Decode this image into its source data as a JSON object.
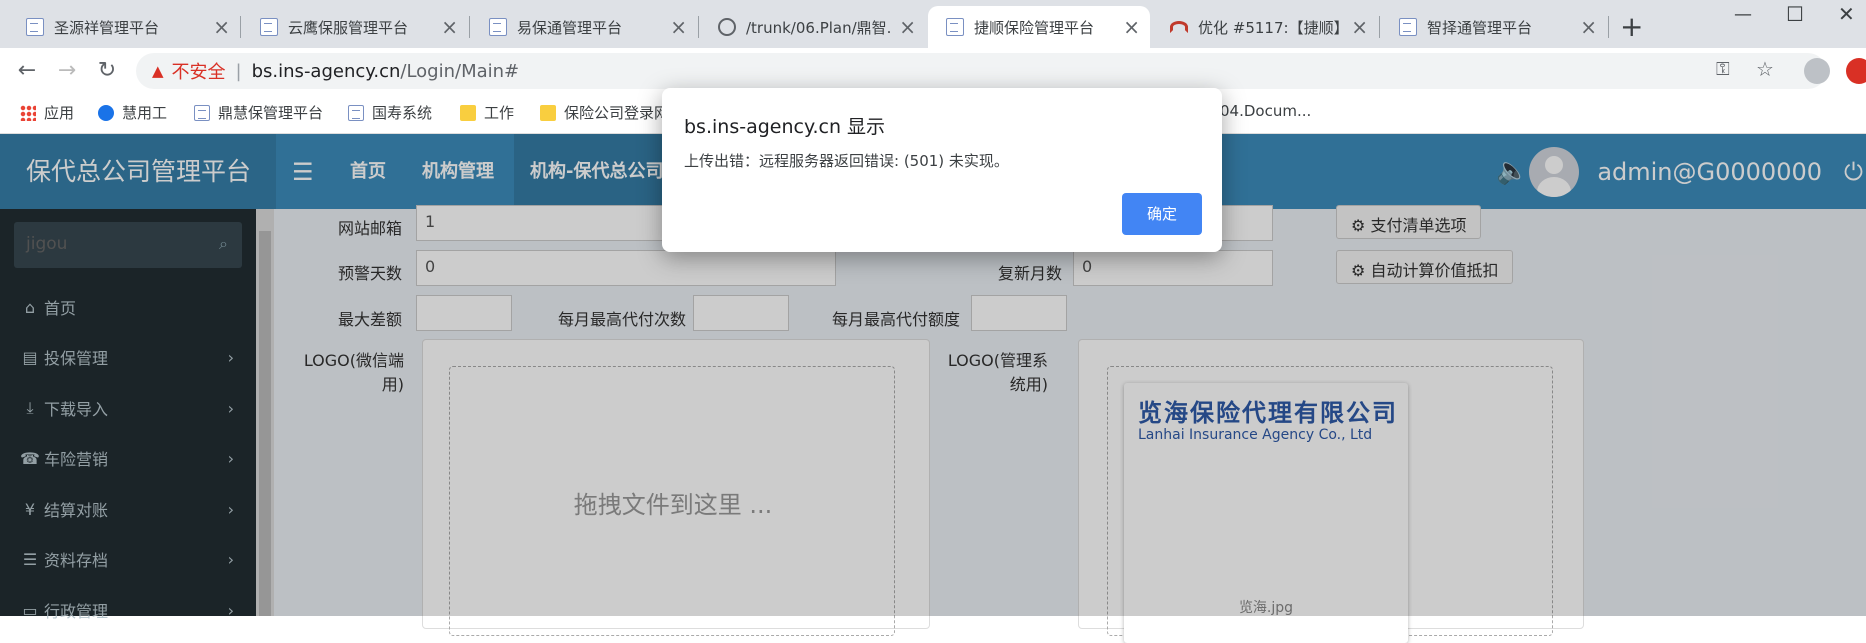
{
  "tabs": [
    {
      "label": "圣源祥管理平台"
    },
    {
      "label": "云鹰保服管理平台"
    },
    {
      "label": "易保通管理平台"
    },
    {
      "label": "/trunk/06.Plan/鼎智..."
    },
    {
      "label": "捷顺保险管理平台"
    },
    {
      "label": "优化 #5117:【捷顺】..."
    },
    {
      "label": "智择通管理平台"
    }
  ],
  "window_controls": {
    "minimize": "—",
    "maximize": "☐",
    "close": "✕",
    "new_tab": "+"
  },
  "address": {
    "not_secure": "不安全",
    "host": "bs.ins-agency.cn",
    "path": "/Login/Main#"
  },
  "bookmarks": [
    {
      "label": "应用"
    },
    {
      "label": "慧用工"
    },
    {
      "label": "鼎慧保管理平台"
    },
    {
      "label": "国寿系统"
    },
    {
      "label": "工作"
    },
    {
      "label": "保险公司登录网..."
    },
    {
      "label": "04.Docum..."
    }
  ],
  "app": {
    "brand": "保代总公司管理平台",
    "nav": [
      "首页",
      "机构管理",
      "机构-保代总公司"
    ],
    "user": "admin@G0000000"
  },
  "sidebar": {
    "search_placeholder": "jigou",
    "items": [
      {
        "label": "首页",
        "icon": "home-icon",
        "glyph": "⌂"
      },
      {
        "label": "投保管理",
        "icon": "file-icon",
        "glyph": "▤"
      },
      {
        "label": "下载导入",
        "icon": "download-icon",
        "glyph": "⤓"
      },
      {
        "label": "车险营销",
        "icon": "phone-icon",
        "glyph": "☎"
      },
      {
        "label": "结算对账",
        "icon": "yen-icon",
        "glyph": "¥"
      },
      {
        "label": "资料存档",
        "icon": "list-icon",
        "glyph": "☰"
      },
      {
        "label": "行政管理",
        "icon": "folder-icon",
        "glyph": "▭"
      }
    ]
  },
  "form": {
    "website_email_label": "网站邮箱",
    "website_email_value": "1",
    "warn_days_label": "预警天数",
    "warn_days_value": "0",
    "renew_months_label": "复新月数",
    "renew_months_value": "0",
    "max_diff_label": "最大差额",
    "max_diff_value": "",
    "monthly_max_times_label": "每月最高代付次数",
    "monthly_max_times_value": "",
    "monthly_max_amount_label": "每月最高代付额度",
    "monthly_max_amount_value": "",
    "pay_list_option_btn": "支付清单选项",
    "auto_calc_btn": "自动计算价值抵扣",
    "logo_wechat_label": "LOGO(微信端用)",
    "logo_admin_label": "LOGO(管理系统用)",
    "dropzone_text": "拖拽文件到这里 ...",
    "logo_company_cn": "览海保险代理有限公司",
    "logo_company_en": "Lanhai Insurance Agency Co., Ltd",
    "logo_filename": "览海.jpg"
  },
  "dialog": {
    "title": "bs.ins-agency.cn 显示",
    "message": "上传出错：远程服务器返回错误: (501) 未实现。",
    "ok": "确定"
  }
}
